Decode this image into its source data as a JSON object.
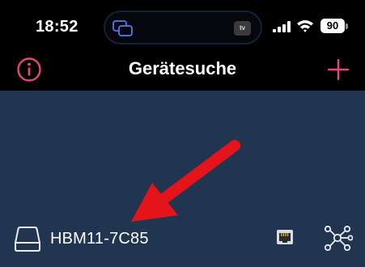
{
  "status_bar": {
    "time": "18:52",
    "battery_level": "90",
    "island_app_badge": "tv",
    "icons": [
      "screen-mirroring-icon",
      "cellular-signal-icon",
      "wifi-icon",
      "battery-icon"
    ]
  },
  "nav": {
    "title": "Gerätesuche",
    "left_icon": "info-icon",
    "right_icon": "plus-icon",
    "accent_color": "#e8457a"
  },
  "devices": [
    {
      "name": "HBM11-7C85",
      "icons": [
        "drive-icon",
        "ethernet-icon",
        "network-topology-icon"
      ]
    }
  ],
  "annotation": {
    "icon": "red-arrow-icon",
    "color": "#e5141b"
  },
  "colors": {
    "background": "#000000",
    "content_background": "#213550"
  }
}
